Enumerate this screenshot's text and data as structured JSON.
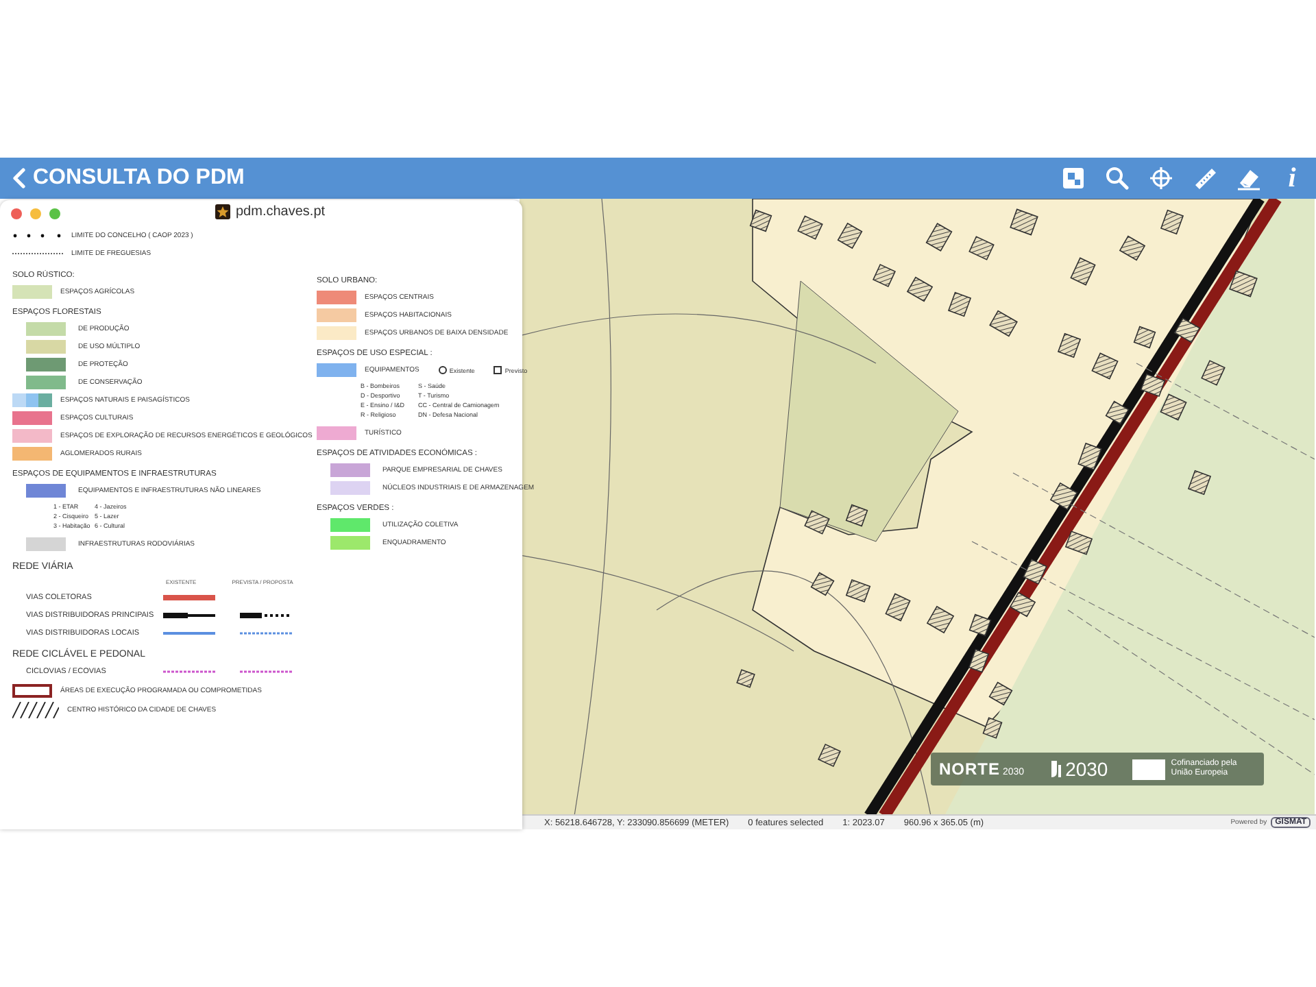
{
  "header": {
    "back_label": "CONSULTA DO PDM",
    "tools": [
      {
        "kind": "overview"
      },
      {
        "kind": "search"
      },
      {
        "kind": "locate"
      },
      {
        "kind": "measure"
      },
      {
        "kind": "erase"
      },
      {
        "kind": "info",
        "glyph": "i"
      }
    ]
  },
  "legend_window": {
    "title": "pdm.chaves.pt",
    "columns": [
      [
        {
          "kind": "county",
          "label": "LIMITE DO CONCELHO ( CAOP 2023 )"
        },
        {
          "kind": "parish",
          "label": "LIMITE DE FREGUESIAS"
        },
        {
          "kind": "heading",
          "label": "SOLO RÚSTICO:"
        },
        {
          "kind": "swatch",
          "color": "#d5e3b6",
          "label": "ESPAÇOS AGRÍCOLAS"
        },
        {
          "kind": "heading",
          "label": "ESPAÇOS FLORESTAIS"
        },
        {
          "kind": "subswatch",
          "color": "#c4dba8",
          "label": "DE PRODUÇÃO"
        },
        {
          "kind": "subswatch",
          "color": "#d8d8a4",
          "label": "DE USO MÚLTIPLO"
        },
        {
          "kind": "subswatch",
          "color": "#6e9a73",
          "label": "DE PROTEÇÃO"
        },
        {
          "kind": "subswatch",
          "color": "#80ba8b",
          "label": "DE CONSERVAÇÃO"
        },
        {
          "kind": "multi",
          "label": "ESPAÇOS NATURAIS E PAISAGÍSTICOS"
        },
        {
          "kind": "swatch",
          "color": "#e8738d",
          "label": "ESPAÇOS CULTURAIS"
        },
        {
          "kind": "swatch",
          "color": "#f3b9c8",
          "label": "ESPAÇOS DE EXPLORAÇÃO DE RECURSOS ENERGÉTICOS E GEOLÓGICOS"
        },
        {
          "kind": "swatch",
          "color": "#f4b772",
          "label": "AGLOMERADOS RURAIS"
        },
        {
          "kind": "heading",
          "label": "ESPAÇOS DE EQUIPAMENTOS E INFRAESTRUTURAS"
        },
        {
          "kind": "subswatch",
          "color": "#6f86d6",
          "label": "EQUIPAMENTOS E INFRAESTRUTURAS NÃO LINEARES"
        },
        {
          "kind": "codes",
          "rows": [
            [
              "1 - ETAR",
              "4 - Jazeiros"
            ],
            [
              "2 - Cisqueiro",
              "5 - Lazer"
            ],
            [
              "3 - Habitação",
              "6 - Cultural"
            ]
          ]
        },
        {
          "kind": "subswatch",
          "color": "#d5d5d5",
          "label": "INFRAESTRUTURAS RODOVIÁRIAS"
        },
        {
          "kind": "major",
          "label": "REDE VIÁRIA"
        },
        {
          "kind": "columns",
          "labels": [
            "EXISTENTE",
            "PREVISTA / PROPOSTA"
          ]
        },
        {
          "kind": "collector",
          "label": "VIAS COLETORAS"
        },
        {
          "kind": "arterial",
          "label": "VIAS DISTRIBUIDORAS PRINCIPAIS"
        },
        {
          "kind": "local",
          "label": "VIAS DISTRIBUIDORAS LOCAIS"
        },
        {
          "kind": "major",
          "label": "REDE CICLÁVEL E PEDONAL"
        },
        {
          "kind": "cycleway",
          "label": "CICLOVIAS / ECOVIAS"
        },
        {
          "kind": "outline",
          "color": "#8b2323",
          "label": "ÁREAS DE EXECUÇÃO PROGRAMADA OU COMPROMETIDAS"
        },
        {
          "kind": "hatch",
          "label": "CENTRO HISTÓRICO DA CIDADE DE CHAVES"
        }
      ],
      [
        {
          "kind": "heading",
          "label": "SOLO URBANO:"
        },
        {
          "kind": "swatch",
          "color": "#ee8a78",
          "label": "ESPAÇOS CENTRAIS"
        },
        {
          "kind": "swatch",
          "color": "#f5caa2",
          "label": "ESPAÇOS HABITACIONAIS"
        },
        {
          "kind": "swatch",
          "color": "#fbeac6",
          "label": "ESPAÇOS URBANOS DE BAIXA DENSIDADE"
        },
        {
          "kind": "heading",
          "label": "ESPAÇOS DE USO ESPECIAL :"
        },
        {
          "kind": "options",
          "color": "#7fb2ee",
          "label": "EQUIPAMENTOS",
          "options": [
            "Existente",
            "Previsto"
          ]
        },
        {
          "kind": "codes",
          "rows": [
            [
              "B - Bombeiros",
              "S - Saúde"
            ],
            [
              "D - Desportivo",
              "T - Turismo"
            ],
            [
              "E - Ensino / I&D",
              "CC - Central de Camionagem"
            ],
            [
              "R - Religioso",
              "DN - Defesa Nacional"
            ]
          ]
        },
        {
          "kind": "swatch",
          "color": "#eeaad2",
          "label": "TURÍSTICO"
        },
        {
          "kind": "heading",
          "label": "ESPAÇOS DE ATIVIDADES ECONÓMICAS :"
        },
        {
          "kind": "subswatch",
          "color": "#c8a5d7",
          "label": "PARQUE EMPRESARIAL DE CHAVES"
        },
        {
          "kind": "subswatch",
          "color": "#ddd3f2",
          "label": "NÚCLEOS INDUSTRIAIS E DE ARMAZENAGEM"
        },
        {
          "kind": "heading",
          "label": "ESPAÇOS VERDES :"
        },
        {
          "kind": "subswatch",
          "color": "#5fe86b",
          "label": "UTILIZAÇÃO COLETIVA"
        },
        {
          "kind": "subswatch",
          "color": "#9ce86b",
          "label": "ENQUADRAMENTO"
        }
      ]
    ]
  },
  "map": {
    "logos": [
      {
        "kind": "norte",
        "label": "NORTE",
        "sub": "2030"
      },
      {
        "kind": "portugal",
        "label": "2030"
      },
      {
        "kind": "eu",
        "label": "Cofinanciado pela União Europeia"
      }
    ],
    "status_bar": {
      "fields": [
        "X: 56218.646728, Y: 233090.856699 (METER)",
        "0 features selected",
        "1: 2023.07",
        "960.96 x 365.05 (m)"
      ],
      "powered_by": "Powered by",
      "brand": "GISMAT"
    }
  }
}
